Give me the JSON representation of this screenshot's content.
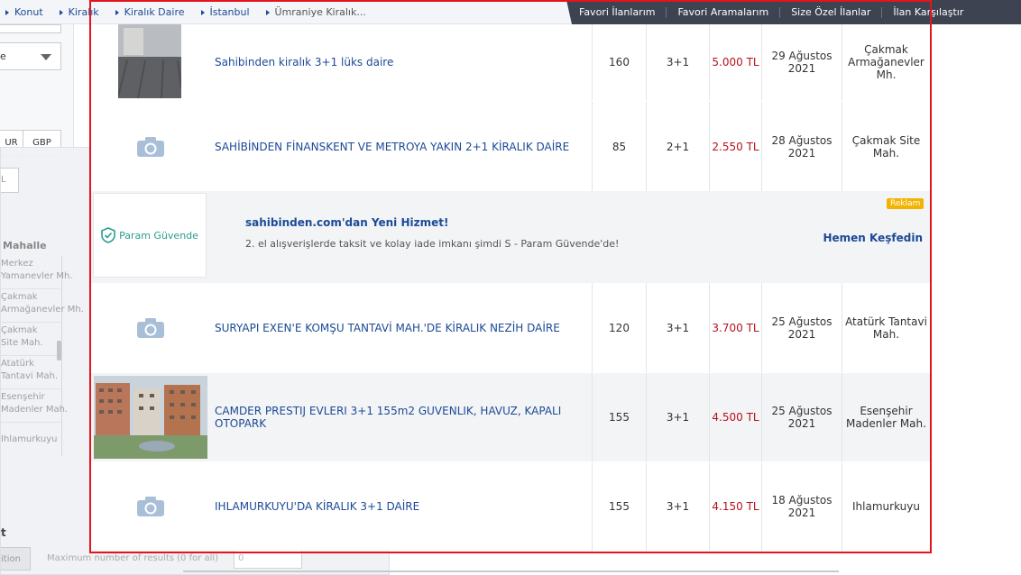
{
  "breadcrumb": [
    "Konut",
    "Kiralık",
    "Kiralık Daire",
    "İstanbul",
    "Ümraniye Kiralık..."
  ],
  "header_tabs": [
    "Favori İlanlarım",
    "Favori Aramalarım",
    "Size Özel İlanlar",
    "İlan Karşılaştır"
  ],
  "filters": {
    "select_value": "e",
    "currency_buttons": [
      "UR",
      "GBP"
    ],
    "currency_input_placeholder": "L",
    "neighborhood_heading": "Mahalle",
    "neighborhoods": [
      "Merkez Yamanevler Mh.",
      "Çakmak Armağanevler Mh.",
      "Çakmak Site Mah.",
      "Atatürk Tantavi Mah.",
      "Esenşehir Madenler Mah.",
      "Ihlamurkuyu"
    ],
    "bottom_section_title": "t",
    "bottom_button_label": "ition",
    "max_results_label": "Maximum number of results (0 for all)",
    "max_results_value": "0"
  },
  "listings": [
    {
      "title": "Sahibinden kiralık 3+1 lüks daire",
      "m2": "160",
      "rooms": "3+1",
      "price": "5.000 TL",
      "date": "29 Ağustos 2021",
      "location": "Çakmak Armağanevler Mh.",
      "image": "photo-floor"
    },
    {
      "title": "SAHİBİNDEN FİNANSKENT VE METROYA YAKIN 2+1 KİRALIK DAİRE",
      "m2": "85",
      "rooms": "2+1",
      "price": "2.550 TL",
      "date": "28 Ağustos 2021",
      "location": "Çakmak Site Mah.",
      "image": "camera-icon"
    },
    {
      "title": "SURYAPI EXEN'E KOMŞU TANTAVİ MAH.'DE KİRALIK NEZİH DAİRE",
      "m2": "120",
      "rooms": "3+1",
      "price": "3.700 TL",
      "date": "25 Ağustos 2021",
      "location": "Atatürk Tantavi Mah.",
      "image": "camera-icon"
    },
    {
      "title": "CAMDER PRESTIJ EVLERI 3+1 155m2 GUVENLIK, HAVUZ, KAPALI OTOPARK",
      "m2": "155",
      "rooms": "3+1",
      "price": "4.500 TL",
      "date": "25 Ağustos 2021",
      "location": "Esenşehir Madenler Mah.",
      "image": "photo-buildings"
    },
    {
      "title": "IHLAMURKUYU'DA KİRALIK 3+1 DAİRE",
      "m2": "155",
      "rooms": "3+1",
      "price": "4.150 TL",
      "date": "18 Ağustos 2021",
      "location": "Ihlamurkuyu",
      "image": "camera-icon"
    }
  ],
  "ad": {
    "logo_text": "Param Güvende",
    "title": "sahibinden.com'dan Yeni Hizmet!",
    "description": "2. el alışverişlerde taksit ve kolay iade imkanı şimdi S - Param Güvende'de!",
    "badge": "Reklam",
    "cta": "Hemen Keşfedin"
  },
  "colors": {
    "price": "#b8111b",
    "link": "#1b4a96",
    "highlight": "#e3141b",
    "ad_badge": "#f2b400"
  }
}
